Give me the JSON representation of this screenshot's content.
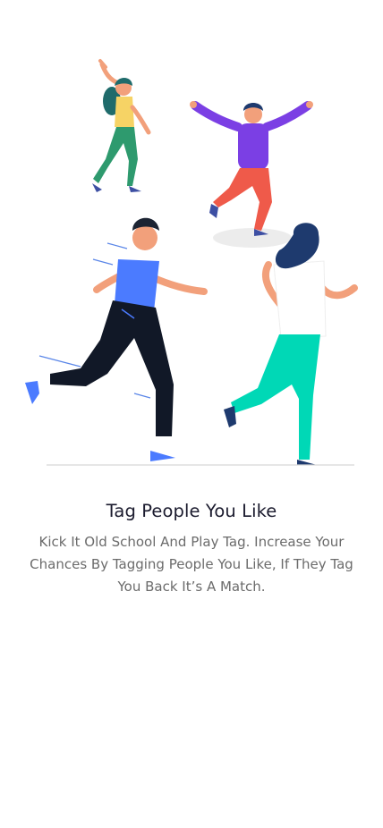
{
  "onboarding": {
    "title": "Tag People You Like",
    "description": "Kick It Old School And Play Tag. Increase Your Chances By Tagging People You Like, If They Tag You Back It’s A Match."
  },
  "colors": {
    "title": "#1b1b2e",
    "description": "#6b6b6b",
    "background": "#ffffff"
  },
  "illustration": {
    "name": "people-playing-tag-illustration"
  }
}
